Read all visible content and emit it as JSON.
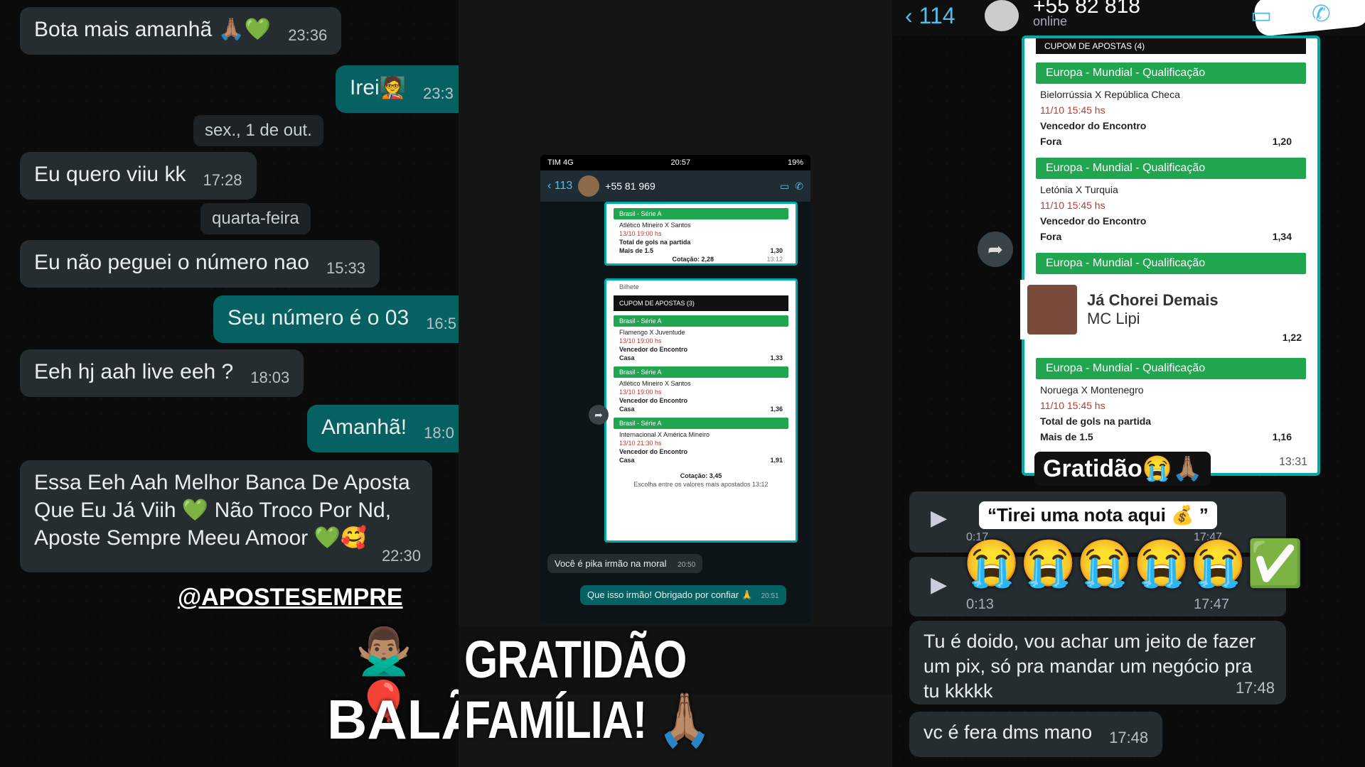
{
  "left": {
    "messages": [
      {
        "dir": "in",
        "text": "Bota mais amanhã 🙏🏽💚",
        "time": "23:36"
      },
      {
        "dir": "out",
        "text": "Irei🧑‍🏫",
        "time": "23:3"
      },
      {
        "dir": "in",
        "text": "Eu quero viiu kk",
        "time": "17:28"
      },
      {
        "dir": "in",
        "text": "Eu não peguei o número nao",
        "time": "15:33"
      },
      {
        "dir": "out",
        "text": "Seu número é o 03",
        "time": "16:5"
      },
      {
        "dir": "in",
        "text": "Eeh hj aah live eeh ?",
        "time": "18:03"
      },
      {
        "dir": "out",
        "text": "Amanhã!",
        "time": "18:0"
      },
      {
        "dir": "in",
        "text": "Essa Eeh Aah Melhor Banca De Aposta Que Eu Já Viih 💚 Não Troco Por Nd, Aposte Sempre Meeu Amoor 💚🥰",
        "time": "22:30"
      }
    ],
    "dates": [
      "sex., 1 de out.",
      "quarta-feira"
    ],
    "handle": "@APOSTESEMPRE",
    "bottom_text": "BALÃ",
    "emojis": "🙅🏽‍♂️🎈"
  },
  "middle": {
    "status": {
      "carrier": "TIM 4G",
      "clock": "20:57",
      "battery": "19%"
    },
    "header": {
      "back": "113",
      "contact": "+55 81 969"
    },
    "coupon_top": {
      "league": "Brasil - Série A",
      "match": "Atlético Mineiro X Santos",
      "date": "13/10 19:00 hs",
      "market": "Total de gols na partida",
      "pick": "Mais de 1.5",
      "odd": "1,30",
      "total_label": "Cotação:",
      "total": "2,28",
      "time": "13:12"
    },
    "coupon": {
      "bilhete": "Bilhete",
      "title": "CUPOM DE APOSTAS (3)",
      "bets": [
        {
          "league": "Brasil - Série A",
          "match": "Flamengo X Juventude",
          "date": "13/10 19:00 hs",
          "market": "Vencedor do Encontro",
          "pick": "Casa",
          "odd": "1,33"
        },
        {
          "league": "Brasil - Série A",
          "match": "Atlético Mineiro X Santos",
          "date": "13/10 19:00 hs",
          "market": "Vencedor do Encontro",
          "pick": "Casa",
          "odd": "1,36"
        },
        {
          "league": "Brasil - Série A",
          "match": "Internacional X América Mineiro",
          "date": "13/10 21:30 hs",
          "market": "Vencedor do Encontro",
          "pick": "Casa",
          "odd": "1,91"
        }
      ],
      "total_label": "Cotação:",
      "total": "3,45",
      "footer": "Escolha entre os valores mais apostados",
      "time": "13:12"
    },
    "msg_in": {
      "text": "Você é pika irmão na moral",
      "time": "20:50"
    },
    "msg_out": {
      "text": "Que isso irmão! Obrigado por confiar 🙏",
      "time": "20:51"
    },
    "banner": "GRATIDÃO FAMÍLIA! 🙏🏽"
  },
  "right": {
    "header": {
      "back": "114",
      "contact": "+55 82 818",
      "status": "online"
    },
    "coupon_title": "CUPOM DE APOSTAS (4)",
    "bets": [
      {
        "league": "Europa - Mundial - Qualificação",
        "match": "Bielorrússia X República Checa",
        "date": "11/10 15:45 hs",
        "market": "Vencedor do Encontro",
        "pick": "Fora",
        "odd": "1,20"
      },
      {
        "league": "Europa - Mundial - Qualificação",
        "match": "Letónia X Turquia",
        "date": "11/10 15:45 hs",
        "market": "Vencedor do Encontro",
        "pick": "Fora",
        "odd": "1,34"
      },
      {
        "league": "Europa - Mundial - Qualificação",
        "match": "",
        "date": "",
        "market": "",
        "pick": "",
        "odd": "1,22"
      },
      {
        "league": "Europa - Mundial - Qualificação",
        "match": "Noruega X Montenegro",
        "date": "11/10 15:45 hs",
        "market": "Total de gols na partida",
        "pick": "Mais de 1.5",
        "odd": "1,16"
      }
    ],
    "music": {
      "title": "Já Chorei Demais",
      "artist": "MC Lipi"
    },
    "coupon_time": "13:31",
    "sticker_gratidao": "Gratidão😭🙏🏽",
    "sticker_quote": "“Tirei uma nota aqui 💰 ”",
    "crying": "😭😭😭😭😭✅",
    "audio1": {
      "duration": "0:17",
      "time": "17:47"
    },
    "audio2": {
      "duration": "0:13",
      "time": "17:47"
    },
    "msg1": {
      "text": "Tu é doido, vou achar um jeito de fazer um pix, só pra mandar um negócio pra tu kkkkk",
      "time": "17:48"
    },
    "msg2": {
      "text": "vc é fera dms mano",
      "time": "17:48"
    }
  },
  "colors": {
    "incoming": "#262d31",
    "outgoing": "#056162",
    "bet_green": "#1fa64f",
    "link_blue": "#53bdeb"
  }
}
